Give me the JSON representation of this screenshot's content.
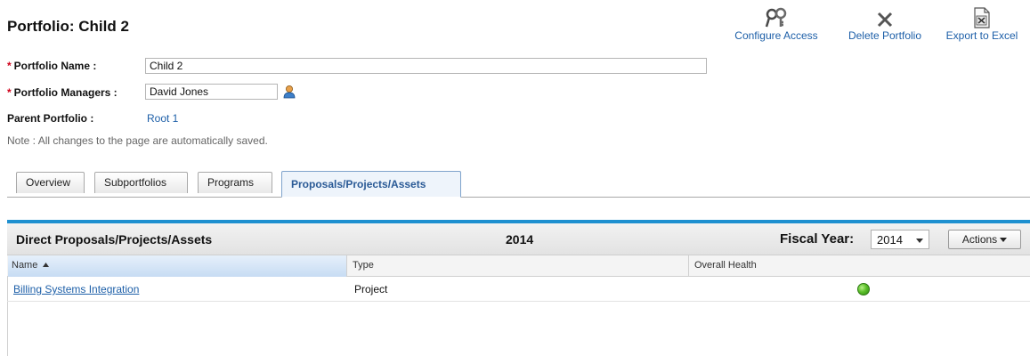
{
  "page": {
    "title": "Portfolio: Child 2"
  },
  "toolbar": {
    "configure_access": "Configure Access",
    "delete_portfolio": "Delete Portfolio",
    "export_excel": "Export to Excel"
  },
  "form": {
    "name_label": "Portfolio Name :",
    "name_value": "Child 2",
    "managers_label": "Portfolio Managers :",
    "managers_value": "David Jones",
    "parent_label": "Parent Portfolio :",
    "parent_value": "Root 1",
    "required_mark": "*",
    "note": "Note : All changes to the page are automatically saved."
  },
  "tabs": [
    {
      "label": "Overview"
    },
    {
      "label": "Subportfolios"
    },
    {
      "label": "Programs"
    },
    {
      "label": "Proposals/Projects/Assets",
      "active": true
    }
  ],
  "section": {
    "title": "Direct Proposals/Projects/Assets",
    "year": "2014",
    "fiscal_year_label": "Fiscal Year:",
    "fiscal_year_value": "2014",
    "actions_label": "Actions"
  },
  "table": {
    "columns": [
      "Name",
      "Type",
      "Overall Health"
    ],
    "sorted_column": "Name",
    "sort_direction": "ascending",
    "rows": [
      {
        "name": "Billing Systems Integration",
        "type": "Project",
        "health": "green"
      }
    ]
  },
  "colors": {
    "link": "#1d5fa8",
    "accent_bar": "#1e90d0",
    "health_green": "#5cc02a",
    "required": "#d0021b"
  },
  "icons": [
    "key-icon",
    "close-icon",
    "excel-export-icon",
    "user-picker-icon",
    "sort-asc-icon",
    "health-indicator-icon"
  ]
}
